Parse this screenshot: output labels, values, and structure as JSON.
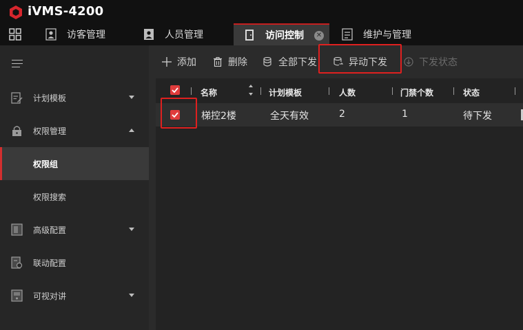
{
  "app": {
    "title": "iVMS-4200"
  },
  "tabs": [
    {
      "label": "访客管理",
      "icon": "visitor-badge-icon"
    },
    {
      "label": "人员管理",
      "icon": "person-card-icon"
    },
    {
      "label": "访问控制",
      "icon": "door-icon",
      "active": true
    },
    {
      "label": "维护与管理",
      "icon": "maintenance-icon"
    }
  ],
  "sidebar": {
    "menu_icon": "hamburger-menu-icon",
    "items": [
      {
        "label": "计划模板",
        "icon": "schedule-template-icon",
        "expand": "down"
      },
      {
        "label": "权限管理",
        "icon": "lock-icon",
        "expand": "up"
      },
      {
        "label": "权限组",
        "selected": true
      },
      {
        "label": "权限搜索"
      },
      {
        "label": "高级配置",
        "icon": "door-panel-icon",
        "expand": "down"
      },
      {
        "label": "联动配置",
        "icon": "linkage-icon"
      },
      {
        "label": "可视对讲",
        "icon": "intercom-icon",
        "expand": "down"
      }
    ]
  },
  "toolbar": {
    "add_label": "添加",
    "delete_label": "删除",
    "apply_all_label": "全部下发",
    "apply_changes_label": "异动下发",
    "apply_status_label": "下发状态"
  },
  "table": {
    "columns": [
      "名称",
      "计划模板",
      "人数",
      "门禁个数",
      "状态"
    ],
    "rows": [
      {
        "name": "梯控2楼",
        "schedule": "全天有效",
        "persons": "2",
        "doors": "1",
        "status": "待下发",
        "checked": true
      }
    ]
  },
  "colors": {
    "accent": "#e03c3c",
    "highlight_box": "#e0201f",
    "sidebar_bg": "#262626",
    "main_bg": "#2b2b2b"
  }
}
